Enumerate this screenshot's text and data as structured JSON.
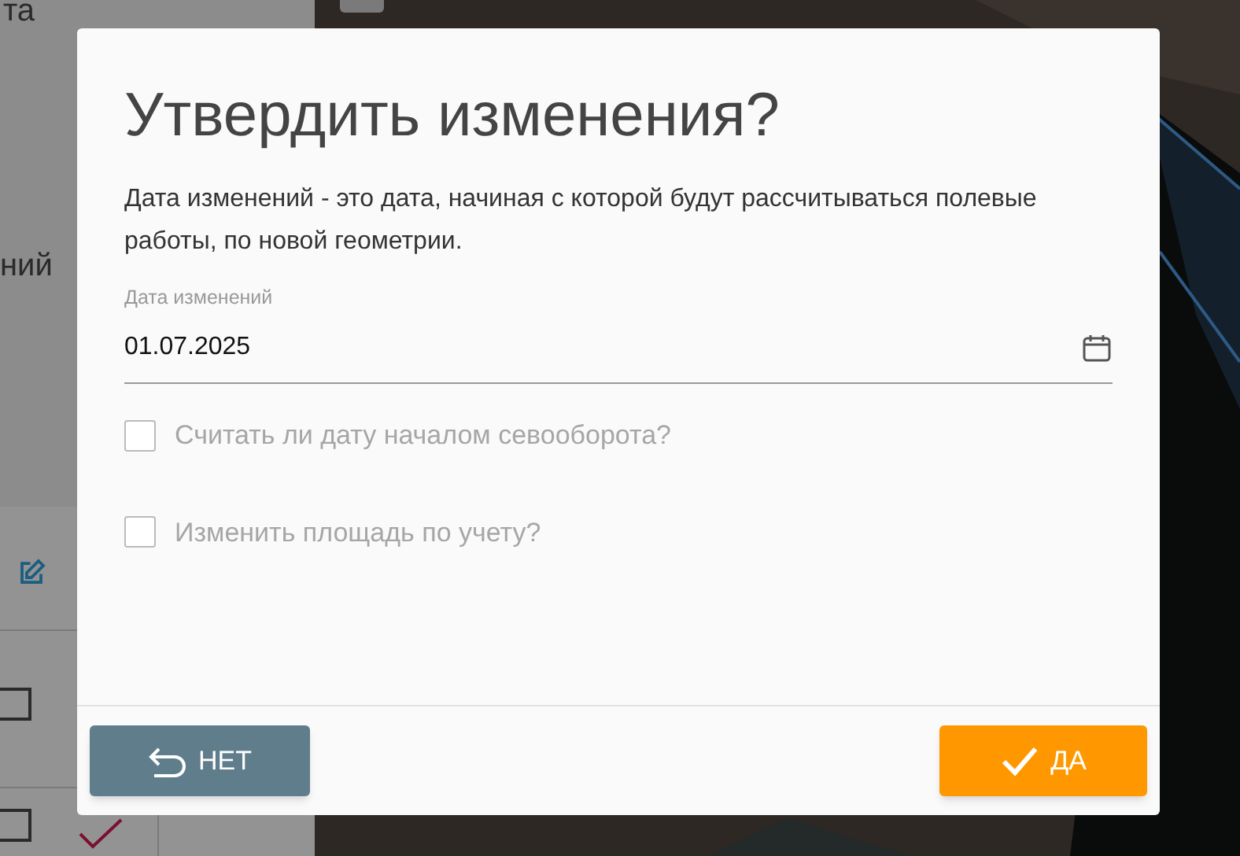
{
  "background": {
    "sidebar_texts": [
      "та",
      "ний"
    ],
    "rows": [
      {
        "checked": false
      },
      {
        "checked": false
      }
    ]
  },
  "dialog": {
    "title": "Утвердить изменения?",
    "description": "Дата изменений - это дата, начиная с которой будут рассчитываться полевые работы, по новой геометрии.",
    "date_field": {
      "label": "Дата изменений",
      "value": "01.07.2025"
    },
    "checkboxes": [
      {
        "label": "Считать ли дату началом севооборота?",
        "checked": false
      },
      {
        "label": "Изменить площадь по учету?",
        "checked": false
      }
    ],
    "buttons": [
      {
        "kind": "cancel",
        "label": "НЕТ"
      },
      {
        "kind": "confirm",
        "label": "ДА"
      }
    ]
  }
}
